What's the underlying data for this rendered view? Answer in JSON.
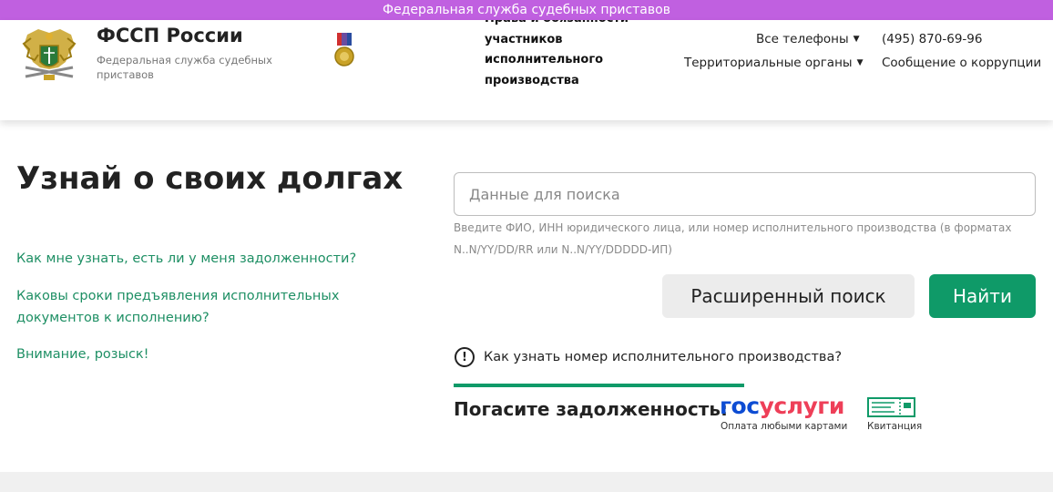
{
  "topbar": {
    "text": "Федеральная служба судебных приставов"
  },
  "header": {
    "title": "ФССП России",
    "subtitle": "Федеральная служба судебных приставов",
    "rights_text": "Права и обязанности участников исполнительного производства",
    "phones_label": "Все телефоны",
    "phone_number": "(495) 870-69-96",
    "territorial_label": "Территориальные органы",
    "corruption_label": "Сообщение о коррупции"
  },
  "main": {
    "title": "Узнай о своих долгах",
    "faq_links": [
      "Как мне узнать, есть ли у меня задолженности?",
      "Каковы сроки предъявления исполнительных документов к исполнению?",
      "Внимание, розыск!"
    ]
  },
  "search": {
    "placeholder": "Данные для поиска",
    "value": "",
    "hint": "Введите ФИО, ИНН юридического лица, или номер исполнительного производства (в форматах N..N/YY/DD/RR или N..N/YY/DDDDD-ИП)",
    "advanced_label": "Расширенный поиск",
    "find_label": "Найти"
  },
  "info": {
    "text": "Как узнать номер исполнительного производства?",
    "icon": "exclamation-circle-icon"
  },
  "payment": {
    "label": "Погасите задолженность:",
    "gosuslugi_part1": "гос",
    "gosuslugi_part2": "услуги",
    "gosuslugi_caption": "Оплата любыми картами",
    "receipt_caption": "Квитанция"
  },
  "colors": {
    "accent": "#0f9a68",
    "topbar": "#c060e0",
    "link": "#1e8f64",
    "gos_blue": "#0d4cd3",
    "gos_red": "#ee3f58"
  }
}
